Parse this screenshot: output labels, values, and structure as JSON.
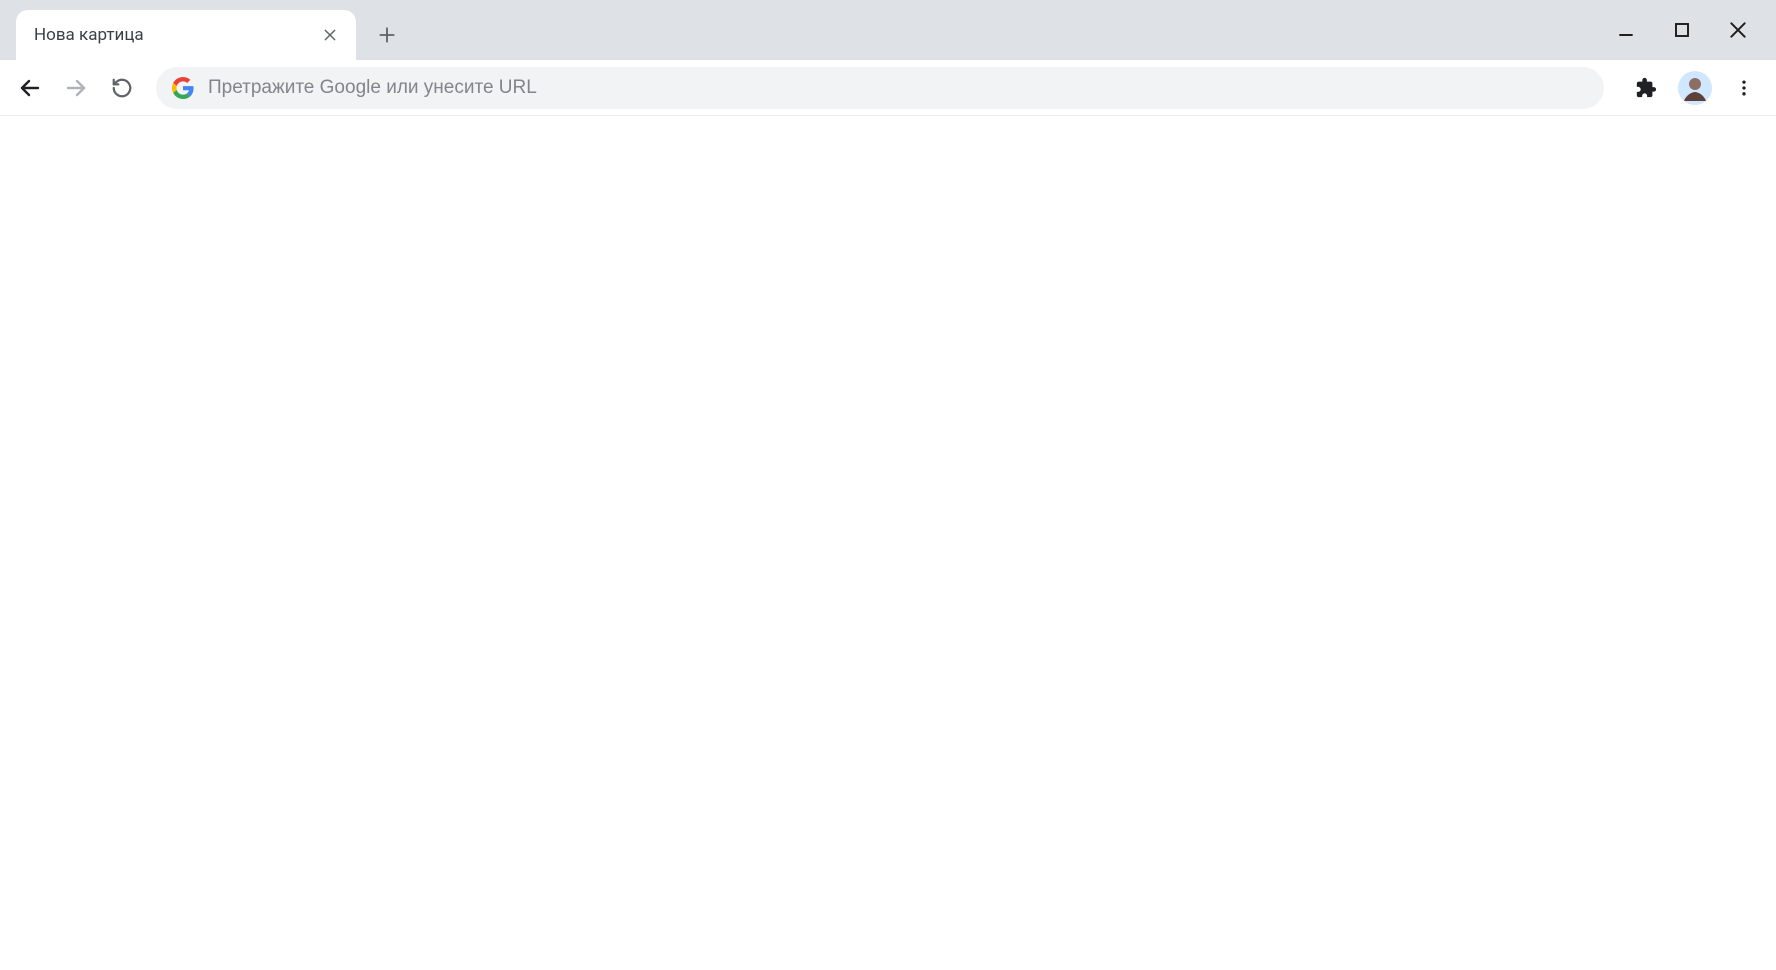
{
  "tab": {
    "title": "Нова картица"
  },
  "omnibox": {
    "placeholder": "Претражите Google или унесите URL",
    "value": ""
  }
}
